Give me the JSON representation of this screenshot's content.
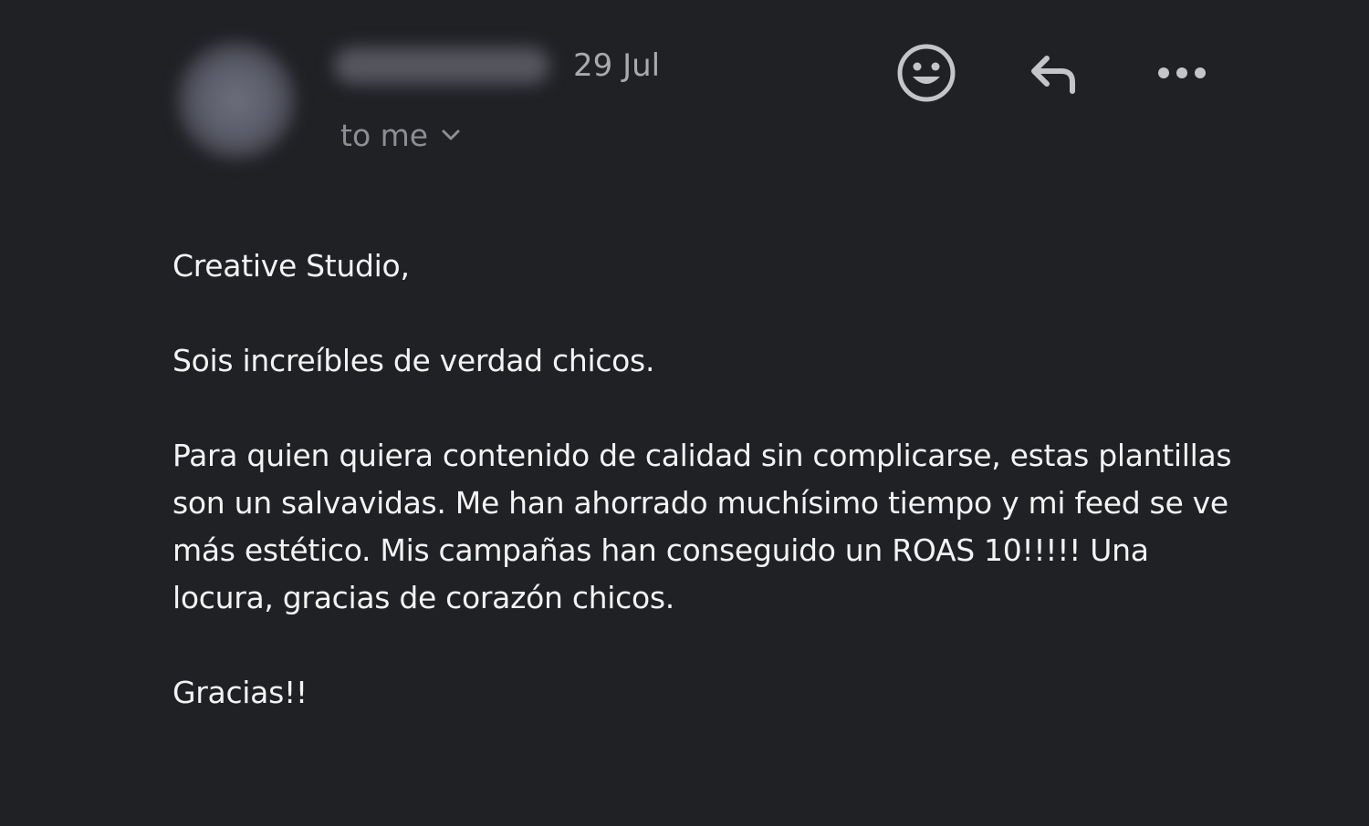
{
  "header": {
    "date": "29 Jul",
    "recipient_label": "to me",
    "icons": {
      "avatar": "blurred-avatar",
      "dropdown": "chevron-down-icon",
      "emoji": "smiley-icon",
      "reply": "reply-arrow-icon",
      "more": "more-horizontal-icon"
    }
  },
  "message": {
    "greeting": "Creative Studio,",
    "line1": "Sois increíbles de verdad chicos.",
    "paragraph": "Para quien quiera contenido de calidad sin complicarse, estas plantillas son un salvavidas. Me han ahorrado muchísimo tiempo y mi feed se ve más estético. Mis campañas han conseguido un ROAS 10!!!!! Una locura, gracias de corazón chicos.",
    "signoff": "Gracias!!"
  },
  "colors": {
    "background": "#202125",
    "text": "#f3f3f3",
    "muted": "#a9aaae",
    "icon": "#c4c5c9"
  }
}
